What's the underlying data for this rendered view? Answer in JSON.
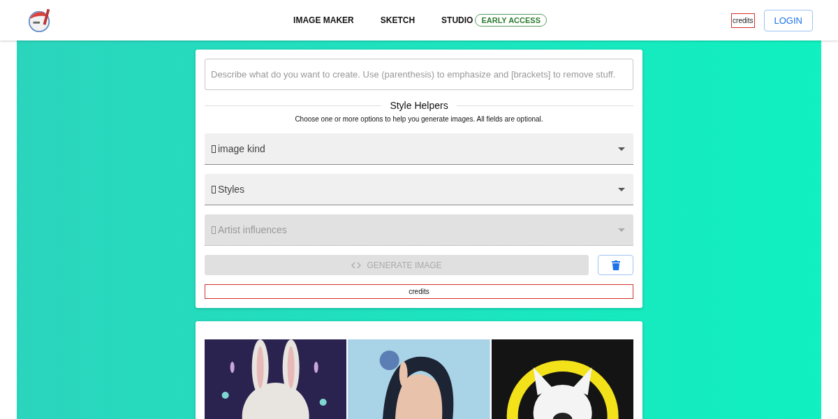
{
  "nav": [
    {
      "label": "IMAGE MAKER"
    },
    {
      "label": "SKETCH"
    },
    {
      "label": "STUDIO",
      "badge": "EARLY ACCESS"
    }
  ],
  "header_credits": "credits",
  "login": "LOGIN",
  "prompt": {
    "placeholder": "Describe what do you want to create. Use (parenthesis) to emphasize and [brackets] to remove stuff."
  },
  "style_helpers": {
    "title": "Style Helpers",
    "hint": "Choose one or more options to help you generate images. All fields are optional."
  },
  "selects": [
    {
      "label": "image kind",
      "disabled": false
    },
    {
      "label": "Styles",
      "disabled": false
    },
    {
      "label": "Artist influences",
      "disabled": true
    }
  ],
  "generate": {
    "label": "GENERATE IMAGE",
    "disabled": true
  },
  "credits": "credits"
}
